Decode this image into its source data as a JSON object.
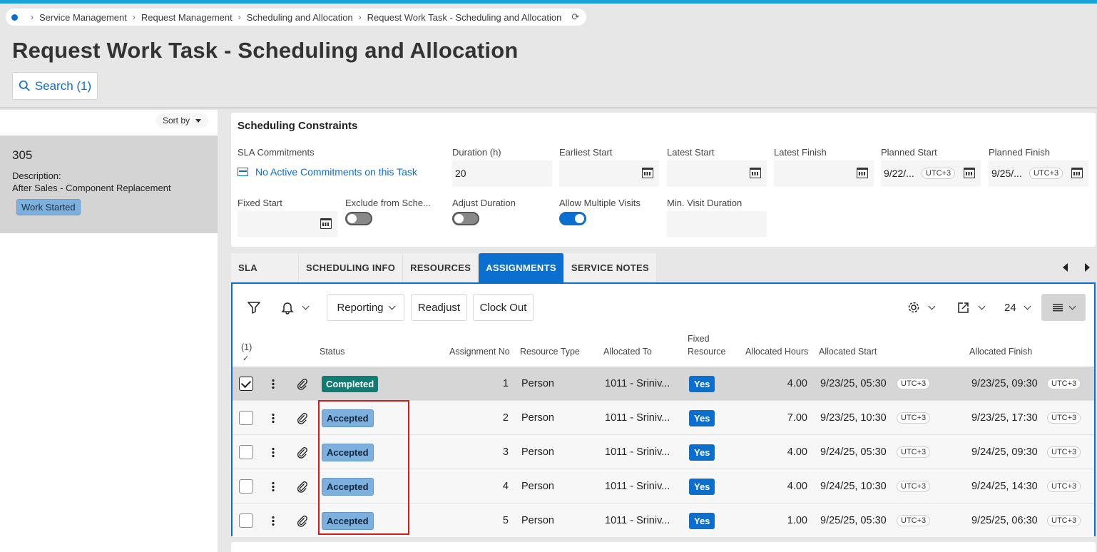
{
  "breadcrumb": {
    "items": [
      "Service Management",
      "Request Management",
      "Scheduling and Allocation",
      "Request Work Task - Scheduling and Allocation"
    ]
  },
  "page": {
    "title": "Request Work Task - Scheduling and Allocation"
  },
  "search": {
    "label": "Search (1)"
  },
  "list": {
    "sort_label": "Sort by",
    "card": {
      "number": "305",
      "description_label": "Description:",
      "description": "After Sales - Component Replacement",
      "status": "Work Started"
    }
  },
  "constraints": {
    "title": "Scheduling Constraints",
    "sla_label": "SLA Commitments",
    "sla_link": "No Active Commitments on this Task",
    "duration_label": "Duration (h)",
    "duration_value": "20",
    "earliest_start_label": "Earliest Start",
    "latest_start_label": "Latest Start",
    "latest_finish_label": "Latest Finish",
    "planned_start_label": "Planned Start",
    "planned_start_value": "9/22/...",
    "planned_finish_label": "Planned Finish",
    "planned_finish_value": "9/25/...",
    "tz": "UTC+3",
    "fixed_start_label": "Fixed Start",
    "exclude_label": "Exclude from Sche...",
    "adjust_label": "Adjust Duration",
    "allow_multi_label": "Allow Multiple Visits",
    "min_visit_label": "Min. Visit Duration",
    "exclude_on": false,
    "adjust_on": false,
    "allow_multi_on": true
  },
  "tabs": [
    "SLA",
    "SCHEDULING INFO",
    "RESOURCES",
    "ASSIGNMENTS",
    "SERVICE NOTES"
  ],
  "active_tab": "ASSIGNMENTS",
  "toolbar": {
    "reporting": "Reporting",
    "readjust": "Readjust",
    "clock_out": "Clock Out",
    "page_size": "24"
  },
  "grid": {
    "selected_count": "(1)",
    "headers": {
      "status": "Status",
      "assignment_no": "Assignment No",
      "resource_type": "Resource Type",
      "allocated_to": "Allocated To",
      "fixed_resource_1": "Fixed",
      "fixed_resource_2": "Resource",
      "allocated_hours": "Allocated Hours",
      "allocated_start": "Allocated Start",
      "allocated_finish": "Allocated Finish"
    },
    "rows": [
      {
        "status": "Completed",
        "no": "1",
        "type": "Person",
        "to": "1011 - Sriniv...",
        "fixed": "Yes",
        "hours": "4.00",
        "start": "9/23/25, 05:30",
        "finish": "9/23/25, 09:30",
        "tz": "UTC+3"
      },
      {
        "status": "Accepted",
        "no": "2",
        "type": "Person",
        "to": "1011 - Sriniv...",
        "fixed": "Yes",
        "hours": "7.00",
        "start": "9/23/25, 10:30",
        "finish": "9/23/25, 17:30",
        "tz": "UTC+3"
      },
      {
        "status": "Accepted",
        "no": "3",
        "type": "Person",
        "to": "1011 - Sriniv...",
        "fixed": "Yes",
        "hours": "4.00",
        "start": "9/24/25, 05:30",
        "finish": "9/24/25, 09:30",
        "tz": "UTC+3"
      },
      {
        "status": "Accepted",
        "no": "4",
        "type": "Person",
        "to": "1011 - Sriniv...",
        "fixed": "Yes",
        "hours": "4.00",
        "start": "9/24/25, 10:30",
        "finish": "9/24/25, 14:30",
        "tz": "UTC+3"
      },
      {
        "status": "Accepted",
        "no": "5",
        "type": "Person",
        "to": "1011 - Sriniv...",
        "fixed": "Yes",
        "hours": "1.00",
        "start": "9/25/25, 05:30",
        "finish": "9/25/25, 06:30",
        "tz": "UTC+3"
      }
    ]
  },
  "colors": {
    "accent": "#0b6fd0",
    "completed": "#0f7d74",
    "accepted": "#7bb0df",
    "highlight": "#d21b1b"
  }
}
